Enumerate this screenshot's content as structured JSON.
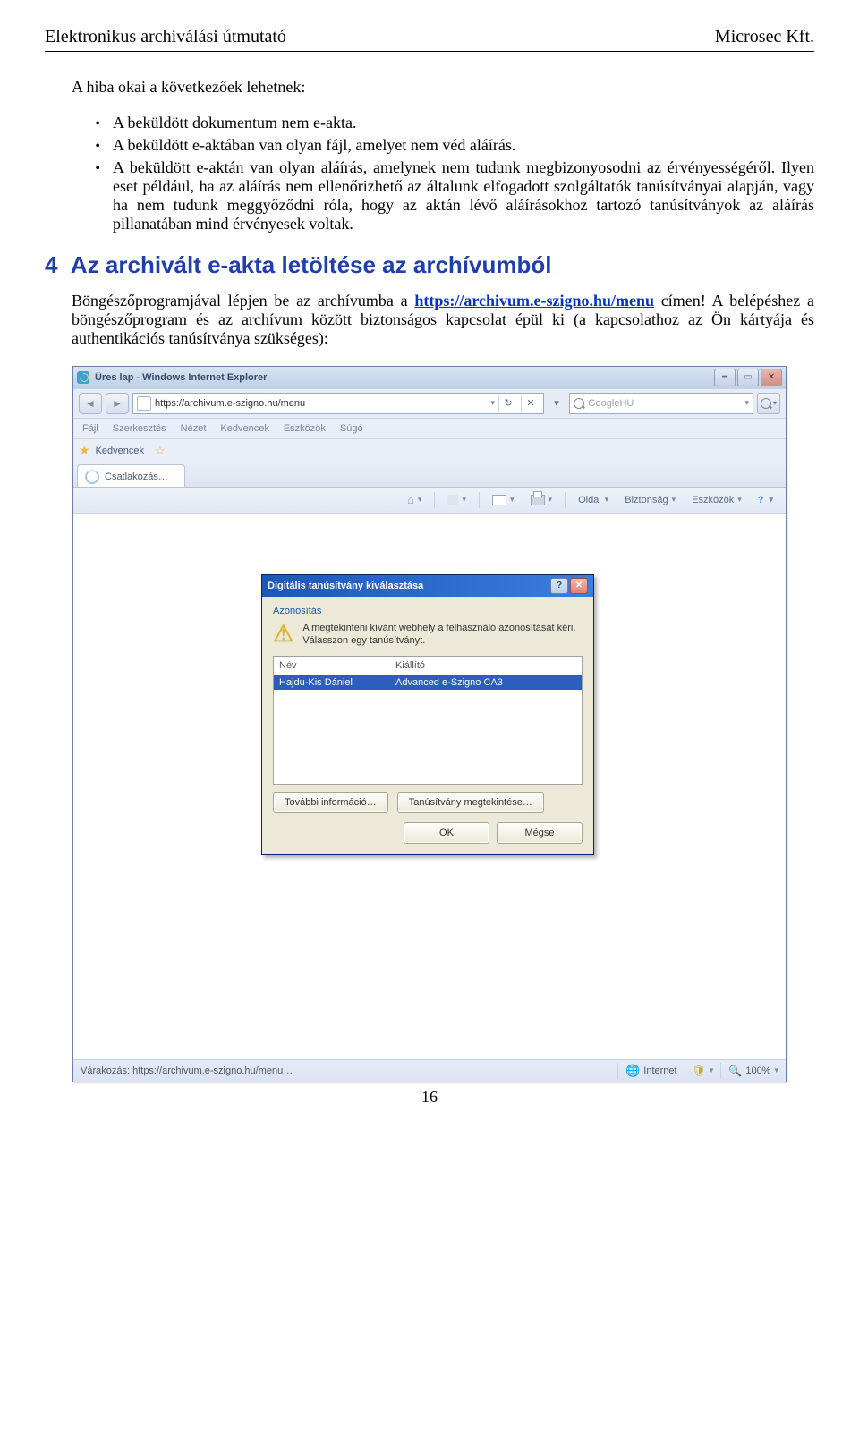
{
  "header": {
    "left": "Elektronikus archiválási útmutató",
    "right": "Microsec Kft."
  },
  "intro_line": "A hiba okai a következőek lehetnek:",
  "bullets": [
    "A beküldött dokumentum nem e-akta.",
    "A beküldött e-aktában van olyan fájl, amelyet nem véd aláírás.",
    "A beküldött e-aktán van olyan aláírás, amelynek nem tudunk megbizonyosodni az érvényességéről. Ilyen eset például, ha az aláírás nem ellenőrizhető az általunk elfogadott szolgáltatók tanúsítványai alapján, vagy ha nem tudunk meggyőződni róla, hogy az aktán lévő aláírásokhoz tartozó tanúsítványok az aláírás pillanatában mind érvényesek voltak."
  ],
  "section": {
    "number": "4",
    "title": "Az archivált e-akta letöltése az archívumból"
  },
  "para2_pre": "Böngészőprogramjával lépjen be az archívumba a ",
  "para2_url": "https://archivum.e-szigno.hu/menu",
  "para2_post": " címen! A belépéshez a böngészőprogram és az archívum között biztonságos kapcsolat épül ki (a kapcsolathoz az Ön kártyája és authentikációs tanúsítványa szükséges):",
  "browser": {
    "title": "Üres lap - Windows Internet Explorer",
    "address": "https://archivum.e-szigno.hu/menu",
    "search_placeholder": "GoogleHU",
    "menu": [
      "Fájl",
      "Szerkesztés",
      "Nézet",
      "Kedvencek",
      "Eszközök",
      "Súgó"
    ],
    "favorites_label": "Kedvencek",
    "tab": "Csatlakozás…",
    "toolbar": {
      "oldal": "Oldal",
      "biztonsag": "Biztonság",
      "eszkozok": "Eszközök"
    },
    "status_left": "Várakozás: https://archivum.e-szigno.hu/menu…",
    "status_zone": "Internet",
    "status_zoom": "100%"
  },
  "dialog": {
    "title": "Digitális tanúsítvány kiválasztása",
    "group": "Azonosítás",
    "msg": "A megtekinteni kívánt webhely a felhasználó azonosítását kéri. Válasszon egy tanúsítványt.",
    "col_nev": "Név",
    "col_kiall": "Kiállító",
    "row_nev": "Hajdu-Kis Dániel",
    "row_kiall": "Advanced e-Szigno CA3",
    "btn_info": "További információ…",
    "btn_view": "Tanúsítvány megtekintése…",
    "btn_ok": "OK",
    "btn_cancel": "Mégse"
  },
  "page_number": "16"
}
